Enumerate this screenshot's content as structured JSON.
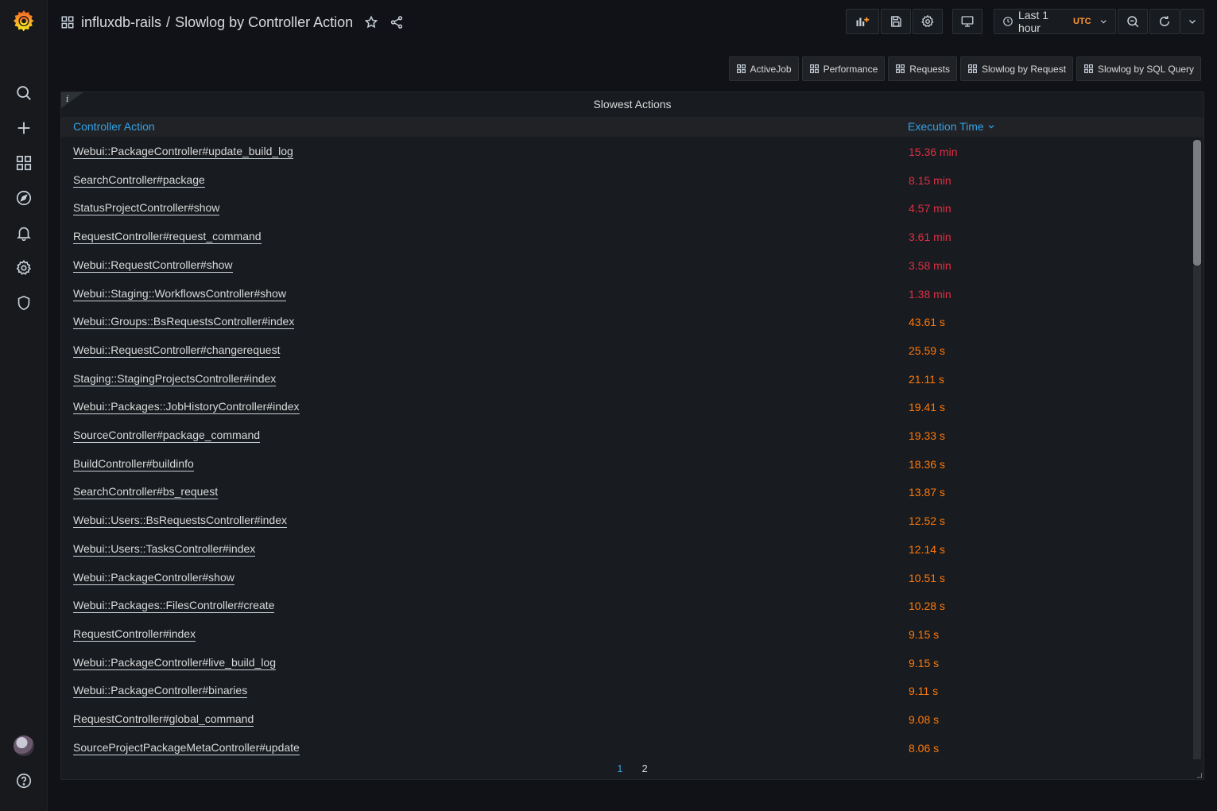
{
  "nav": {
    "breadcrumb_folder": "influxdb-rails",
    "breadcrumb_sep": "/",
    "breadcrumb_title": "Slowlog by Controller Action"
  },
  "toolbar": {
    "time_range": "Last 1 hour",
    "timezone": "UTC"
  },
  "links": [
    {
      "label": "ActiveJob"
    },
    {
      "label": "Performance"
    },
    {
      "label": "Requests"
    },
    {
      "label": "Slowlog by Request"
    },
    {
      "label": "Slowlog by SQL Query"
    }
  ],
  "panel": {
    "info": "i",
    "title": "Slowest Actions",
    "columns": [
      "Controller Action",
      "Execution Time"
    ],
    "rows": [
      {
        "action": "Webui::PackageController#update_build_log",
        "time": "15.36 min",
        "status": "red"
      },
      {
        "action": "SearchController#package",
        "time": "8.15 min",
        "status": "red"
      },
      {
        "action": "StatusProjectController#show",
        "time": "4.57 min",
        "status": "red"
      },
      {
        "action": "RequestController#request_command",
        "time": "3.61 min",
        "status": "red"
      },
      {
        "action": "Webui::RequestController#show",
        "time": "3.58 min",
        "status": "red"
      },
      {
        "action": "Webui::Staging::WorkflowsController#show",
        "time": "1.38 min",
        "status": "red"
      },
      {
        "action": "Webui::Groups::BsRequestsController#index",
        "time": "43.61 s",
        "status": "orange"
      },
      {
        "action": "Webui::RequestController#changerequest",
        "time": "25.59 s",
        "status": "orange"
      },
      {
        "action": "Staging::StagingProjectsController#index",
        "time": "21.11 s",
        "status": "orange"
      },
      {
        "action": "Webui::Packages::JobHistoryController#index",
        "time": "19.41 s",
        "status": "orange"
      },
      {
        "action": "SourceController#package_command",
        "time": "19.33 s",
        "status": "orange"
      },
      {
        "action": "BuildController#buildinfo",
        "time": "18.36 s",
        "status": "orange"
      },
      {
        "action": "SearchController#bs_request",
        "time": "13.87 s",
        "status": "orange"
      },
      {
        "action": "Webui::Users::BsRequestsController#index",
        "time": "12.52 s",
        "status": "orange"
      },
      {
        "action": "Webui::Users::TasksController#index",
        "time": "12.14 s",
        "status": "orange"
      },
      {
        "action": "Webui::PackageController#show",
        "time": "10.51 s",
        "status": "orange"
      },
      {
        "action": "Webui::Packages::FilesController#create",
        "time": "10.28 s",
        "status": "orange"
      },
      {
        "action": "RequestController#index",
        "time": "9.15 s",
        "status": "orange"
      },
      {
        "action": "Webui::PackageController#live_build_log",
        "time": "9.15 s",
        "status": "orange"
      },
      {
        "action": "Webui::PackageController#binaries",
        "time": "9.11 s",
        "status": "orange"
      },
      {
        "action": "RequestController#global_command",
        "time": "9.08 s",
        "status": "orange"
      },
      {
        "action": "SourceProjectPackageMetaController#update",
        "time": "8.06 s",
        "status": "orange"
      }
    ],
    "pages": [
      "1",
      "2"
    ],
    "current_page": "1"
  },
  "colors": {
    "red": "#e02f44",
    "orange": "#ff780a",
    "link_blue": "#33a2e5",
    "grafana_orange": "#f46800"
  }
}
